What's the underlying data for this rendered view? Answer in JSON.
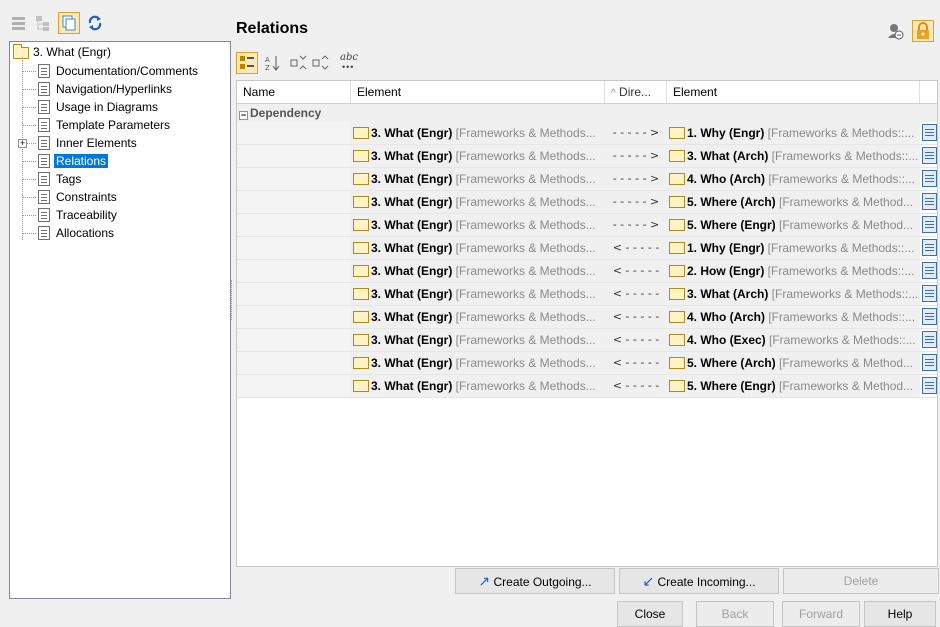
{
  "tree": {
    "root": "3. What (Engr)",
    "items": [
      "Documentation/Comments",
      "Navigation/Hyperlinks",
      "Usage in Diagrams",
      "Template Parameters",
      "Inner Elements",
      "Relations",
      "Tags",
      "Constraints",
      "Traceability",
      "Allocations"
    ],
    "selected": "Relations",
    "expander_symbol": "+"
  },
  "panel": {
    "title": "Relations",
    "toolbar_abc": "abc"
  },
  "grid": {
    "headers": {
      "name": "Name",
      "element1": "Element",
      "direction": "Dire...",
      "sort_indicator": "^",
      "element2": "Element"
    },
    "group_label": "Dependency",
    "group_collapse_symbol": "−",
    "rows": [
      {
        "e1_bold": "3. What (Engr)",
        "e1_grey": " [Frameworks & Methods...",
        "dir": "- - - - - >",
        "e2_bold": "1. Why (Engr)",
        "e2_grey": " [Frameworks & Methods::..."
      },
      {
        "e1_bold": "3. What (Engr)",
        "e1_grey": " [Frameworks & Methods...",
        "dir": "- - - - - >",
        "e2_bold": "3. What (Arch)",
        "e2_grey": " [Frameworks & Methods::..."
      },
      {
        "e1_bold": "3. What (Engr)",
        "e1_grey": " [Frameworks & Methods...",
        "dir": "- - - - - >",
        "e2_bold": "4. Who (Arch)",
        "e2_grey": " [Frameworks & Methods::..."
      },
      {
        "e1_bold": "3. What (Engr)",
        "e1_grey": " [Frameworks & Methods...",
        "dir": "- - - - - >",
        "e2_bold": "5. Where (Arch)",
        "e2_grey": " [Frameworks & Method..."
      },
      {
        "e1_bold": "3. What (Engr)",
        "e1_grey": " [Frameworks & Methods...",
        "dir": "- - - - - >",
        "e2_bold": "5. Where (Engr)",
        "e2_grey": " [Frameworks & Method..."
      },
      {
        "e1_bold": "3. What (Engr)",
        "e1_grey": " [Frameworks & Methods...",
        "dir": "< - - - - -",
        "e2_bold": "1. Why (Engr)",
        "e2_grey": " [Frameworks & Methods::..."
      },
      {
        "e1_bold": "3. What (Engr)",
        "e1_grey": " [Frameworks & Methods...",
        "dir": "< - - - - -",
        "e2_bold": "2. How (Engr)",
        "e2_grey": " [Frameworks & Methods::..."
      },
      {
        "e1_bold": "3. What (Engr)",
        "e1_grey": " [Frameworks & Methods...",
        "dir": "< - - - - -",
        "e2_bold": "3. What (Arch)",
        "e2_grey": " [Frameworks & Methods::..."
      },
      {
        "e1_bold": "3. What (Engr)",
        "e1_grey": " [Frameworks & Methods...",
        "dir": "< - - - - -",
        "e2_bold": "4. Who (Arch)",
        "e2_grey": " [Frameworks & Methods::..."
      },
      {
        "e1_bold": "3. What (Engr)",
        "e1_grey": " [Frameworks & Methods...",
        "dir": "< - - - - -",
        "e2_bold": "4. Who (Exec)",
        "e2_grey": " [Frameworks & Methods::..."
      },
      {
        "e1_bold": "3. What (Engr)",
        "e1_grey": " [Frameworks & Methods...",
        "dir": "< - - - - -",
        "e2_bold": "5. Where (Arch)",
        "e2_grey": " [Frameworks & Method..."
      },
      {
        "e1_bold": "3. What (Engr)",
        "e1_grey": " [Frameworks & Methods...",
        "dir": "< - - - - -",
        "e2_bold": "5. Where (Engr)",
        "e2_grey": " [Frameworks & Method..."
      }
    ]
  },
  "actions": {
    "create_outgoing": "Create Outgoing...",
    "create_incoming": "Create Incoming...",
    "delete": "Delete"
  },
  "footer": {
    "close": "Close",
    "back": "Back",
    "forward": "Forward",
    "help": "Help"
  },
  "colors": {
    "selection": "#0078d7",
    "folder_fill": "#fff3c4",
    "folder_stroke": "#b08a1c",
    "accent_orange": "#f0a020",
    "arrow_blue": "#2060c0"
  }
}
